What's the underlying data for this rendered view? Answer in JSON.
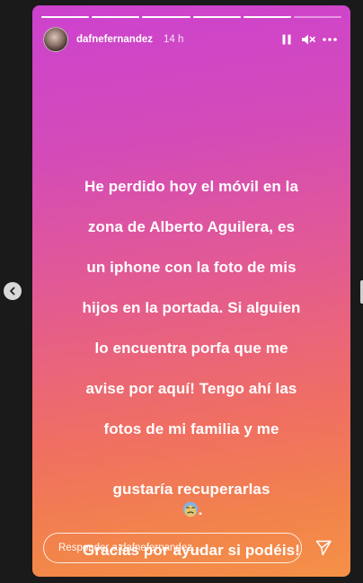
{
  "story": {
    "username": "dafnefernandez",
    "time": "14 h",
    "progress_segments": [
      1,
      1,
      1,
      1,
      1,
      0
    ],
    "message_lines": [
      "He perdido hoy el móvil en la",
      "zona de Alberto Aguilera, es",
      "un iphone con la foto de mis",
      "hijos en la portada. Si alguien",
      "lo encuentra porfa que me",
      "avise por aquí! Tengo ahí las",
      "fotos de mi familia y me",
      "gustaría recuperarlas",
      "Gracias por ayudar si podéis!"
    ],
    "emoji": "sad-face-emoji",
    "gradient_colors": [
      "#cc42cf",
      "#e45c8e",
      "#f59148"
    ]
  },
  "controls": {
    "pause_icon": "pause-icon",
    "mute_icon": "muted-speaker-icon",
    "more_icon": "more-options-icon"
  },
  "reply": {
    "placeholder": "Responder a dafnefernandez...",
    "send_icon": "send-icon"
  },
  "nav": {
    "prev_icon": "chevron-left-icon"
  }
}
